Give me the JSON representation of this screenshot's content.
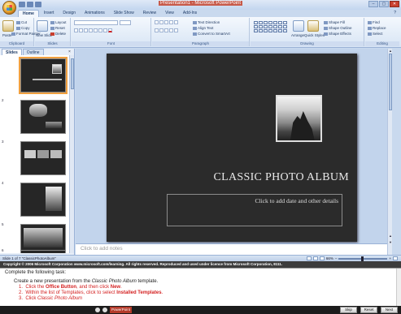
{
  "window": {
    "title_app": "Presentation1 - Microsoft PowerPoint",
    "controls": [
      "–",
      "▢",
      "✕"
    ]
  },
  "tabs": [
    "Home",
    "Insert",
    "Design",
    "Animations",
    "Slide Show",
    "Review",
    "View",
    "Add-Ins"
  ],
  "ribbon": {
    "clipboard": {
      "paste": "Paste",
      "cut": "Cut",
      "copy": "Copy",
      "format_painter": "Format Painter",
      "label": "Clipboard"
    },
    "slides": {
      "new_slide": "New Slide",
      "layout": "Layout",
      "reset": "Reset",
      "delete": "Delete",
      "label": "Slides"
    },
    "font": {
      "label": "Font"
    },
    "paragraph": {
      "text_direction": "Text Direction",
      "align_text": "Align Text",
      "convert": "Convert to SmartArt",
      "label": "Paragraph"
    },
    "drawing": {
      "arrange": "Arrange",
      "quick_styles": "Quick Styles",
      "shape_fill": "Shape Fill",
      "shape_outline": "Shape Outline",
      "shape_effects": "Shape Effects",
      "label": "Drawing"
    },
    "editing": {
      "find": "Find",
      "replace": "Replace",
      "select": "Select",
      "label": "Editing"
    }
  },
  "panel": {
    "tabs": [
      "Slides",
      "Outline"
    ],
    "close": "×",
    "thumbnail_numbers": [
      "1",
      "2",
      "3",
      "4",
      "5",
      "6"
    ]
  },
  "slide": {
    "title": "CLASSIC PHOTO ALBUM",
    "subtitle": "Click to add date and other details"
  },
  "notes": {
    "placeholder": "Click to add notes"
  },
  "status": {
    "left": "Slide 1 of 7   \"ClassicPhotoAlbum\"",
    "zoom": "66%"
  },
  "tutorial": {
    "copyright": "Copyright © 2006 Microsoft Corporation www.microsoft.com/learning. All rights reserved.  Reproduced and used under licence from Microsoft Corporation, 8111.",
    "intro": "Complete the following task:",
    "task_prefix": "Create a new presentation from the ",
    "task_template": "Classic Photo Album",
    "task_suffix": " template.",
    "steps": [
      {
        "n": "1.",
        "pre": "Click the ",
        "bold": "Office Button",
        "post": ", and then click ",
        "bold2": "New",
        "end": "."
      },
      {
        "n": "2.",
        "pre": "Within the list of Templates, click to select ",
        "bold": "Installed Templates",
        "post": ".",
        "bold2": "",
        "end": ""
      },
      {
        "n": "3.",
        "pre": "Click ",
        "bold": "Classic Photo Album",
        "post": "",
        "bold2": "",
        "end": ""
      }
    ],
    "app_badge": "PowerPoint",
    "buttons": {
      "skip": "Skip",
      "reset": "Reset",
      "next": "Next"
    }
  }
}
